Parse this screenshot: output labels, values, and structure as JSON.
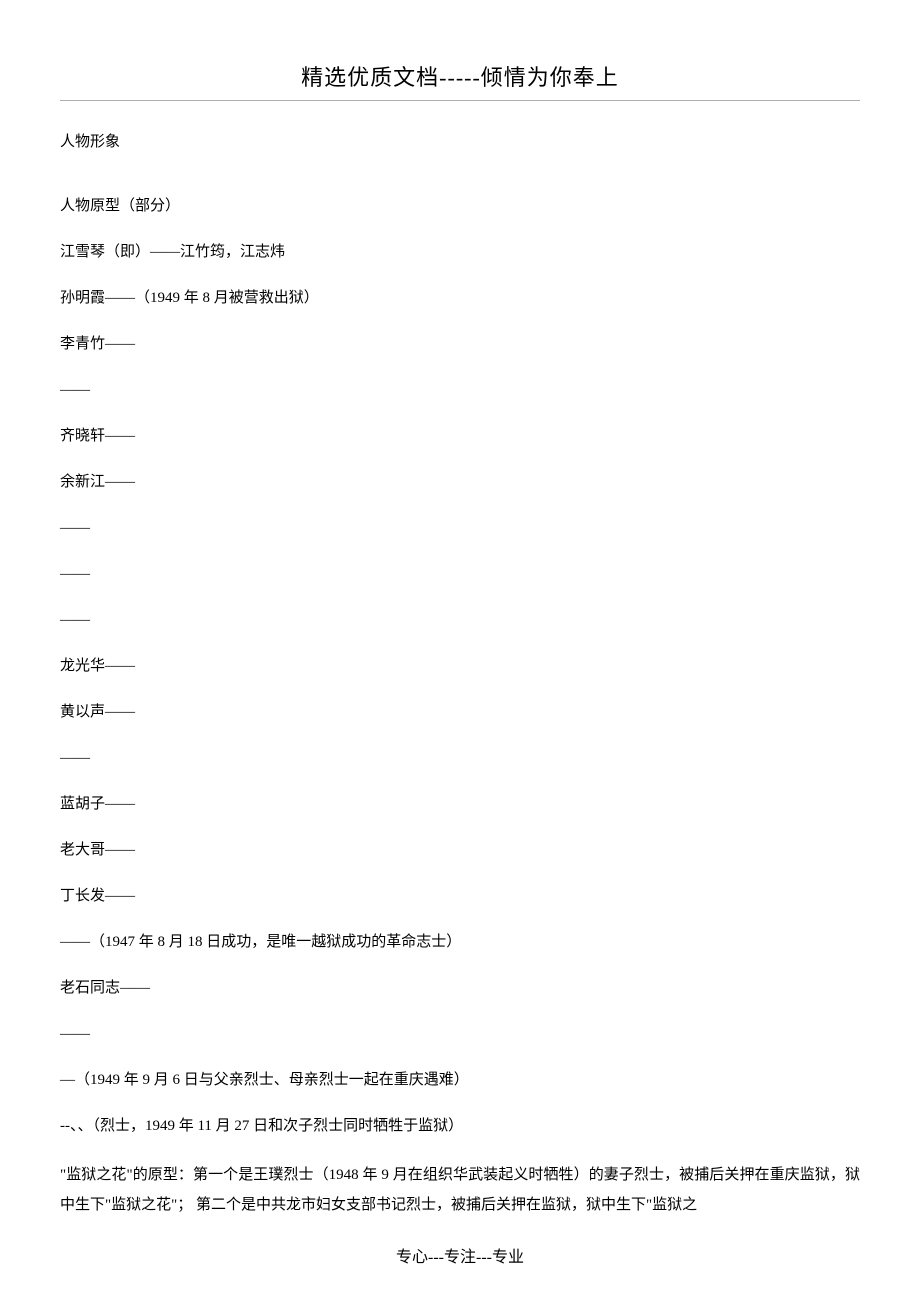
{
  "header": {
    "title": "精选优质文档-----倾情为你奉上"
  },
  "sectionTitle": "人物形象",
  "lines": [
    "人物原型（部分）",
    "江雪琴（即）——江竹筠，江志炜",
    "孙明霞——（1949 年 8 月被营救出狱）",
    "李青竹——",
    "——",
    "齐晓轩——",
    "余新江——",
    "——",
    "——",
    "——",
    "龙光华——",
    "黄以声——",
    "——",
    "蓝胡子——",
    "老大哥——",
    "丁长发——",
    "——（1947 年 8 月 18 日成功，是唯一越狱成功的革命志士）",
    "老石同志——",
    "——",
    "—（1949 年 9 月 6 日与父亲烈士、母亲烈士一起在重庆遇难）",
    "--、、（烈士，1949 年 11 月 27 日和次子烈士同时牺牲于监狱）"
  ],
  "paragraph": "\"监狱之花\"的原型：第一个是王璞烈士（1948 年 9 月在组织华武装起义时牺牲）的妻子烈士，被捕后关押在重庆监狱，狱中生下\"监狱之花\"；  第二个是中共龙市妇女支部书记烈士，被捕后关押在监狱，狱中生下\"监狱之",
  "footer": "专心---专注---专业"
}
